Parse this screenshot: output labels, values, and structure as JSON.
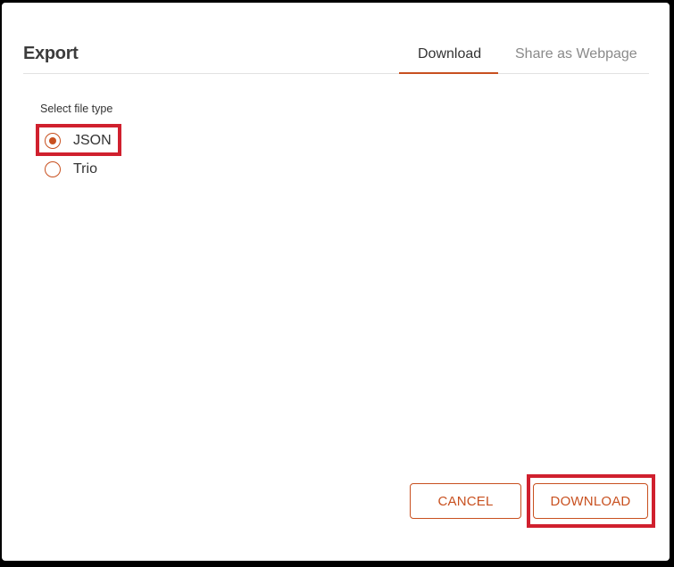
{
  "dialog": {
    "title": "Export",
    "tabs": [
      {
        "label": "Download",
        "active": true
      },
      {
        "label": "Share as Webpage",
        "active": false
      }
    ]
  },
  "file_type": {
    "label": "Select file type",
    "options": [
      {
        "label": "JSON",
        "selected": true
      },
      {
        "label": "Trio",
        "selected": false
      }
    ]
  },
  "buttons": {
    "cancel_label": "CANCEL",
    "download_label": "DOWNLOAD"
  },
  "colors": {
    "accent": "#c8501f",
    "highlight": "#d0202e",
    "frame": "#000000"
  }
}
